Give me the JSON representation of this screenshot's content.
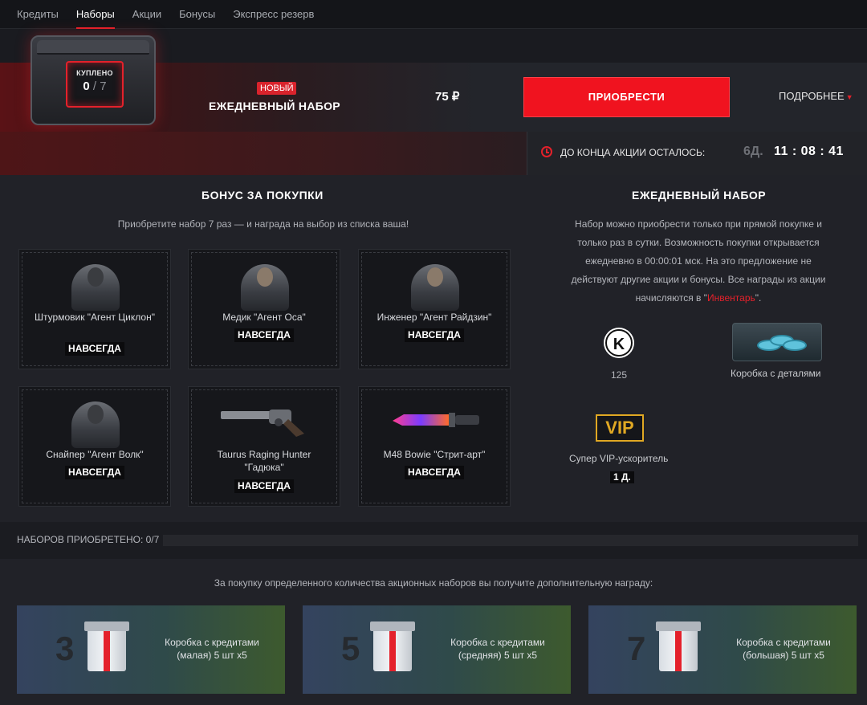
{
  "nav": {
    "tabs": [
      {
        "label": "Кредиты"
      },
      {
        "label": "Наборы"
      },
      {
        "label": "Акции"
      },
      {
        "label": "Бонусы"
      },
      {
        "label": "Экспресс резерв"
      }
    ],
    "active_tab": "Наборы"
  },
  "banner": {
    "bought_label": "КУПЛЕНО",
    "bought_count": "0",
    "bought_total": "7",
    "new_badge": "НОВЫЙ",
    "pack_name": "ЕЖЕДНЕВНЫЙ НАБОР",
    "price": "75 ₽",
    "buy_button": "ПРИОБРЕСТИ",
    "more_link": "ПОДРОБНЕЕ"
  },
  "timer": {
    "label": "ДО КОНЦА АКЦИИ ОСТАЛОСЬ:",
    "days": "6Д.",
    "time": "11 : 08 : 41"
  },
  "bonus": {
    "title": "БОНУС ЗА ПОКУПКИ",
    "subtitle": "Приобретите набор 7 раз — и награда на выбор из списка ваша!",
    "items": [
      {
        "name": "Штурмовик \"Агент Циклон\"",
        "duration": "НАВСЕГДА",
        "icon": "assault-agent-portrait"
      },
      {
        "name": "Медик \"Агент Оса\"",
        "duration": "НАВСЕГДА",
        "icon": "medic-agent-portrait"
      },
      {
        "name": "Инженер \"Агент Райдзин\"",
        "duration": "НАВСЕГДА",
        "icon": "engineer-agent-portrait"
      },
      {
        "name": "Снайпер \"Агент Волк\"",
        "duration": "НАВСЕГДА",
        "icon": "sniper-agent-portrait"
      },
      {
        "name": "Taurus Raging Hunter \"Гадюка\"",
        "duration": "НАВСЕГДА",
        "icon": "revolver-image"
      },
      {
        "name": "M48 Bowie \"Стрит-арт\"",
        "duration": "НАВСЕГДА",
        "icon": "knife-image"
      }
    ]
  },
  "daily": {
    "title": "ЕЖЕДНЕВНЫЙ НАБОР",
    "description_before": "Набор можно приобрести только при прямой покупке и только раз в сутки. Возможность покупки открывается ежедневно в 00:00:01 мск. На это предложение не действуют другие акции и бонусы. Все награды из акции начисляются в \"",
    "inventory_link": "Инвентарь",
    "description_after": "\".",
    "k_symbol": "K",
    "k_amount": "125",
    "parts_box_label": "Коробка с деталями",
    "vip_symbol": "VIP",
    "vip_label": "Супер VIP-ускоритель",
    "vip_days": "1 Д."
  },
  "progress": {
    "label": "НАБОРОВ ПРИОБРЕТЕНО: 0/7",
    "fraction": 0
  },
  "rewards": {
    "intro": "За покупку определенного количества акционных наборов вы получите дополнительную награду:",
    "tiers": [
      {
        "count": "3",
        "line1": "Коробка с кредитами",
        "line2": "(малая) 5 шт x5"
      },
      {
        "count": "5",
        "line1": "Коробка с кредитами",
        "line2": "(средняя) 5 шт x5"
      },
      {
        "count": "7",
        "line1": "Коробка с кредитами",
        "line2": "(большая) 5 шт x5"
      }
    ]
  },
  "colors": {
    "accent": "#e4212b",
    "vip": "#e0a823",
    "background": "#1b1d22"
  }
}
